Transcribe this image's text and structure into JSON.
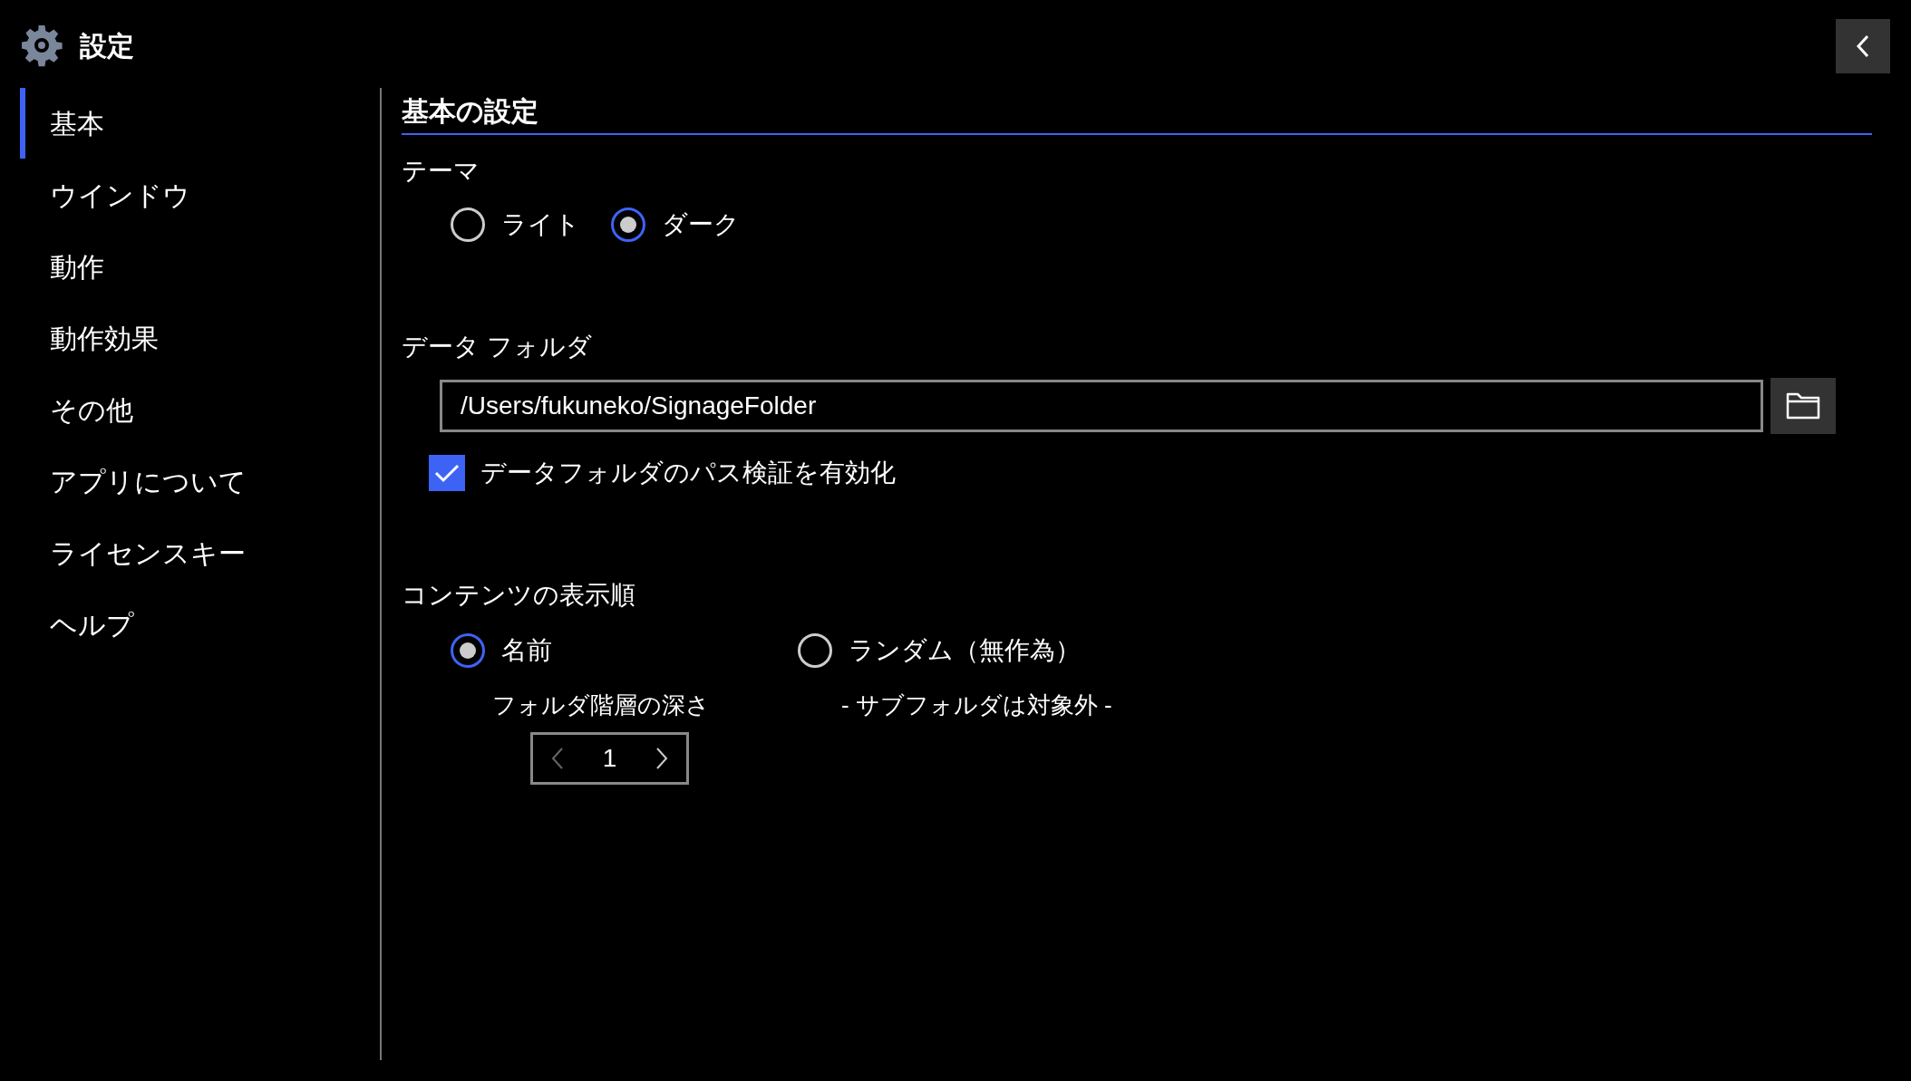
{
  "title": "設定",
  "sidebar": {
    "items": [
      {
        "label": "基本",
        "selected": true
      },
      {
        "label": "ウインドウ",
        "selected": false
      },
      {
        "label": "動作",
        "selected": false
      },
      {
        "label": "動作効果",
        "selected": false
      },
      {
        "label": "その他",
        "selected": false
      },
      {
        "label": "アプリについて",
        "selected": false
      },
      {
        "label": "ライセンスキー",
        "selected": false
      },
      {
        "label": "ヘルプ",
        "selected": false
      }
    ]
  },
  "section_title": "基本の設定",
  "theme": {
    "label": "テーマ",
    "options": [
      {
        "label": "ライト",
        "selected": false
      },
      {
        "label": "ダーク",
        "selected": true
      }
    ]
  },
  "data_folder": {
    "label": "データ フォルダ",
    "value": "/Users/fukuneko/SignageFolder",
    "validate": {
      "label": "データフォルダのパス検証を有効化",
      "checked": true
    }
  },
  "content_order": {
    "label": "コンテンツの表示順",
    "options": [
      {
        "label": "名前",
        "selected": true,
        "note": "フォルダ階層の深さ"
      },
      {
        "label": "ランダム（無作為）",
        "selected": false,
        "note": "- サブフォルダは対象外 -"
      }
    ],
    "depth_stepper": {
      "value": "1",
      "decrease_disabled": true,
      "increase_disabled": false
    }
  }
}
